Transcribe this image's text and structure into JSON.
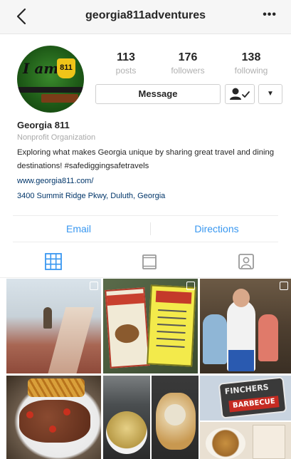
{
  "header": {
    "username": "georgia811adventures",
    "more_label": "•••"
  },
  "profile": {
    "avatar": {
      "line1": "I am",
      "badge": "811"
    },
    "stats": [
      {
        "value": "113",
        "label": "posts"
      },
      {
        "value": "176",
        "label": "followers"
      },
      {
        "value": "138",
        "label": "following"
      }
    ],
    "message_label": "Message",
    "caret": "▼",
    "name": "Georgia 811",
    "category": "Nonprofit Organization",
    "bio": "Exploring what makes Georgia unique by sharing great travel and dining destinations! #safediggingsafetravels",
    "website": "www.georgia811.com/",
    "address": "3400 Summit Ridge Pkwy, Duluth, Georgia"
  },
  "contact": {
    "email_label": "Email",
    "directions_label": "Directions"
  },
  "tabs": [
    {
      "icon": "grid-icon",
      "active": true
    },
    {
      "icon": "feed-icon",
      "active": false
    },
    {
      "icon": "tagged-icon",
      "active": false
    }
  ],
  "grid": {
    "sign_line1": "FINCHERS",
    "sign_line2": "BARBECUE"
  },
  "colors": {
    "link": "#003569",
    "accent": "#3897f0",
    "muted": "#a9a9a9"
  }
}
